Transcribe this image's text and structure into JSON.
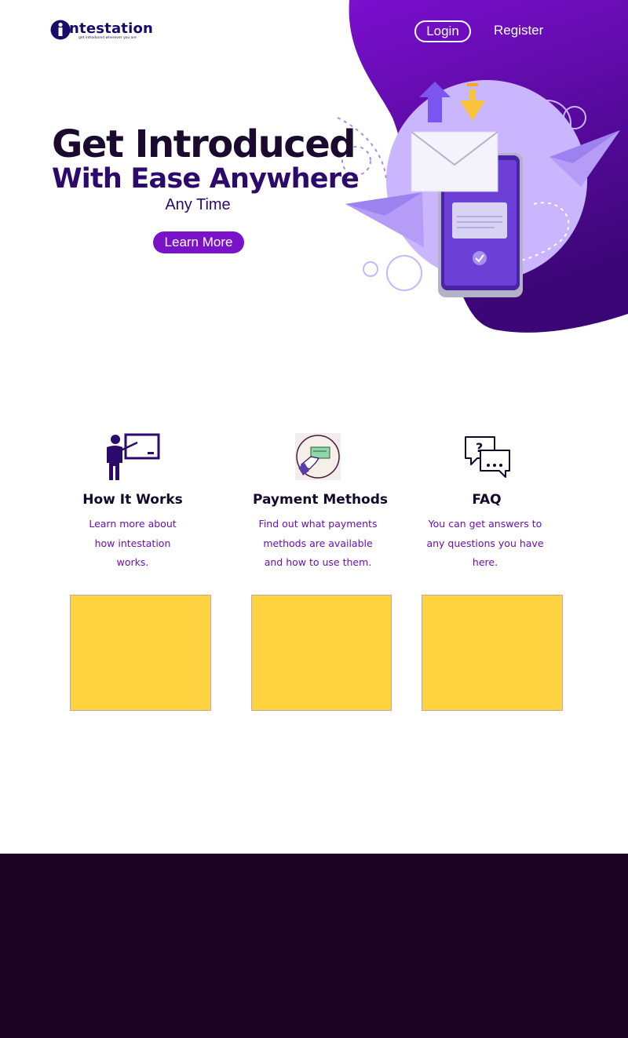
{
  "brand": {
    "name": "ntestation",
    "tagline": "get introduced wherever you are",
    "colors": {
      "primary": "#7a12c9",
      "dark": "#1a0a2e",
      "accent": "#ffd23f",
      "footer": "#1c0322"
    }
  },
  "nav": {
    "login_label": "Login",
    "register_label": "Register"
  },
  "hero": {
    "title": "Get Introduced",
    "subtitle": "With Ease Anywhere",
    "tagline": "Any Time",
    "cta_label": "Learn More",
    "illustration": "phone-mail-paper-plane-illustration"
  },
  "features": [
    {
      "icon": "teacher-board-icon",
      "title": "How It Works",
      "desc_lines": [
        "Learn more about",
        "how intestation",
        "works."
      ]
    },
    {
      "icon": "hand-payment-card-icon",
      "title": "Payment Methods",
      "desc_lines": [
        "Find out what payments",
        "methods are available",
        "and how to use them."
      ]
    },
    {
      "icon": "chat-question-icon",
      "title": "FAQ",
      "desc_lines": [
        "You can get answers to",
        "any questions you have",
        "here."
      ]
    }
  ]
}
